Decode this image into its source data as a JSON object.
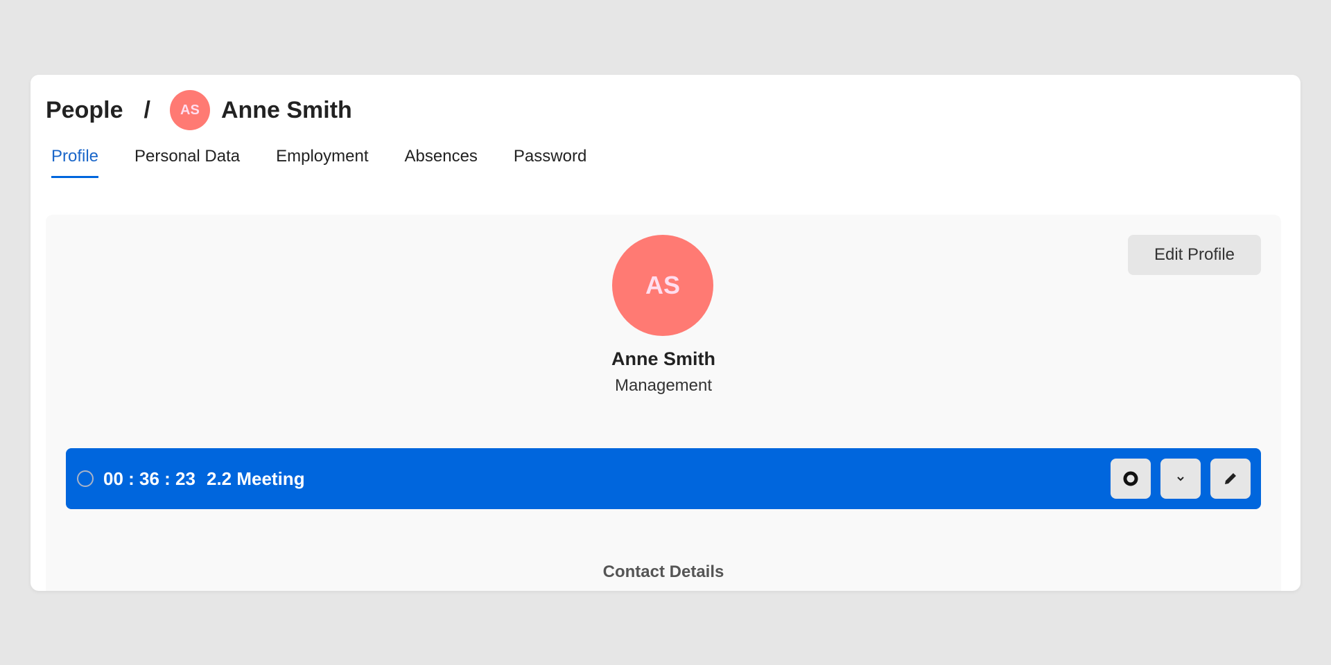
{
  "breadcrumb": {
    "root": "People",
    "separator": "/",
    "avatar_initials": "AS",
    "current": "Anne Smith"
  },
  "tabs": [
    {
      "label": "Profile",
      "active": true
    },
    {
      "label": "Personal Data"
    },
    {
      "label": "Employment"
    },
    {
      "label": "Absences"
    },
    {
      "label": "Password"
    }
  ],
  "profile": {
    "initials": "AS",
    "name": "Anne Smith",
    "department": "Management",
    "edit_label": "Edit Profile",
    "avatar_color": "#ff7a73"
  },
  "timer": {
    "time": "00 : 36 : 23",
    "task": "2.2 Meeting",
    "bar_color": "#0066dd",
    "icons": [
      "stop-icon",
      "chevron-down-icon",
      "pencil-icon"
    ]
  },
  "section": {
    "contact_title": "Contact Details"
  }
}
